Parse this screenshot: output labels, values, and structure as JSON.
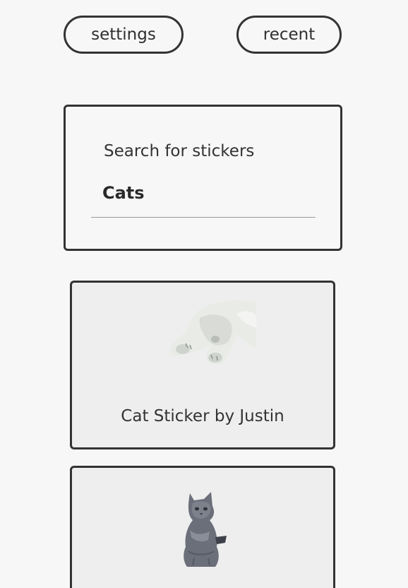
{
  "header": {
    "settings_label": "settings",
    "recent_label": "recent"
  },
  "search": {
    "label": "Search for stickers",
    "value": "Cats"
  },
  "stickers": [
    {
      "caption": "Cat Sticker by Justin",
      "icon": "cat-sticker-image"
    },
    {
      "caption": "",
      "icon": "cat-sticker-image"
    }
  ]
}
